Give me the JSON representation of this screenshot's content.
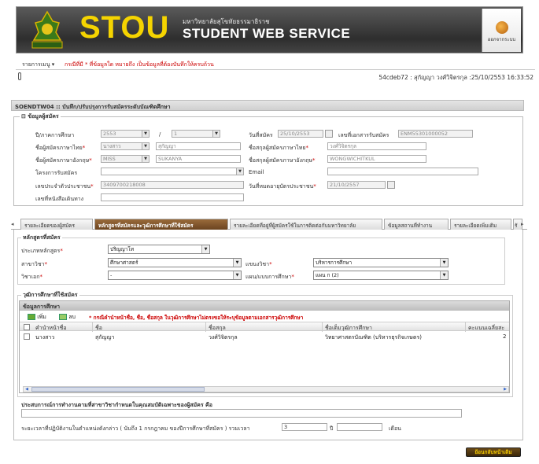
{
  "header": {
    "logo_text": "STOU",
    "university_th": "มหาวิทยาลัยสุโขทัยธรรมาธิราช",
    "app_title": "STUDENT WEB SERVICE",
    "logout_label": "ออกจากระบบ"
  },
  "menubar": {
    "menu_label": "รายการเมนู",
    "required_note": "กรณีที่มี * ที่ข้อมูลใด หมายถึง เป็นข้อมูลที่ต้องบันทึกให้ครบถ้วน"
  },
  "userbar": {
    "user_info": "54cdeb72 : สุกัญญา วงศ์วิจิตรกุล :25/10/2553 16:33:52"
  },
  "page_title": "SOENDTW04 :: บันทึก/ปรับปรุงการรับสมัครระดับบัณฑิตศึกษา",
  "applicant": {
    "legend": "ข้อมูลผู้สมัคร",
    "year_label": "ปี/ภาคการศึกษา",
    "year_value": "2553",
    "slash": "/",
    "term_value": "1",
    "apply_date_label": "วันที่สมัคร",
    "apply_date_value": "25/10/2553",
    "appno_label": "เลขที่เอกสารรับสมัคร",
    "appno_value": "ENM55301000052",
    "prefix_th_label": "ชื่อผู้สมัครภาษาไทย",
    "prefix_th_value": "นางสาว",
    "firstname_th_value": "สุกัญญา",
    "lastname_th_label": "ชื่อสกุลผู้สมัครภาษาไทย",
    "lastname_th_value": "วงศ์วิจิตรกุล",
    "prefix_en_label": "ชื่อผู้สมัครภาษาอังกฤษ",
    "prefix_en_value": "MISS",
    "firstname_en_value": "SUKANYA",
    "lastname_en_label": "ชื่อสกุลผู้สมัครภาษาอังกฤษ",
    "lastname_en_value": "WONGWICHITKUL",
    "project_label": "โครงการรับสมัคร",
    "project_value": "",
    "email_label": "Email",
    "email_value": "",
    "idcard_label": "เลขประจำตัวประชาชน",
    "idcard_value": "3409700218008",
    "idcard_exp_label": "วันที่หมดอายุบัตรประชาชน",
    "idcard_exp_value": "21/10/2557",
    "passport_label": "เลขที่หนังสือเดินทาง",
    "passport_value": ""
  },
  "tabs": [
    "รายละเอียดของผู้สมัคร",
    "หลักสูตรที่สมัครและวุฒิการศึกษาที่ใช้สมัคร",
    "รายละเอียดที่อยู่ที่ผู้สมัครใช้ในการติดต่อกับมหาวิทยาลัย",
    "ข้อมูลสถานที่ทำงาน",
    "รายละเอียดเพิ่มเติม",
    "รั"
  ],
  "program": {
    "legend": "หลักสูตรที่สมัคร",
    "type_label": "ประเภทหลักสูตร",
    "type_value": "ปริญญาโท",
    "branch_label": "สาขาวิชา",
    "branch_value": "ศึกษาศาสตร์",
    "major_label": "แขนงวิชา",
    "major_value": "บริหารการศึกษา",
    "minor_label": "วิชาเอก",
    "minor_value": "-",
    "plan_label": "แผน/แบบการศึกษา",
    "plan_value": "แผน ก (2)"
  },
  "education": {
    "legend": "วุฒิการศึกษาที่ใช้สมัคร",
    "grid_title": "ข้อมูลการศึกษา",
    "add_label": "เพิ่ม",
    "delete_label": "ลบ",
    "grid_note": "* กรณีคำนำหน้าชื่อ, ชื่อ, ชื่อสกุล ในวุฒิการศึกษาไม่ตรงขอให้ระบุข้อมูลตามเอกสารวุฒิการศึกษา",
    "columns": [
      "คำนำหน้าชื่อ",
      "ชื่อ",
      "ชื่อสกุล",
      "ชื่อเต็มวุฒิการศึกษา",
      "คะแนนเฉลี่ยสะ"
    ],
    "rows": [
      [
        "นางสาว",
        "สุกัญญา",
        "วงศ์วิจิตรกุล",
        "วิทยาศาสตรบัณฑิต (บริหารธุรกิจเกษตร)",
        "2"
      ]
    ]
  },
  "experience": {
    "question": "ประสบการณ์การทำงานตามที่สาขาวิชากำหนดในคุณสมบัติเฉพาะของผู้สมัคร คือ",
    "answer": "",
    "duration_label": "ระยะเวลาที่ปฏิบัติงานในตำแหน่งดังกล่าว ( นับถึง 1 กรกฎาคม ของปีการศึกษาที่สมัคร ) รวมเวลา",
    "years_value": "3",
    "years_unit": "ปี",
    "months_value": "",
    "months_unit": "เดือน"
  },
  "footer": {
    "back_label": "ย้อนกลับหน้าเดิม"
  }
}
